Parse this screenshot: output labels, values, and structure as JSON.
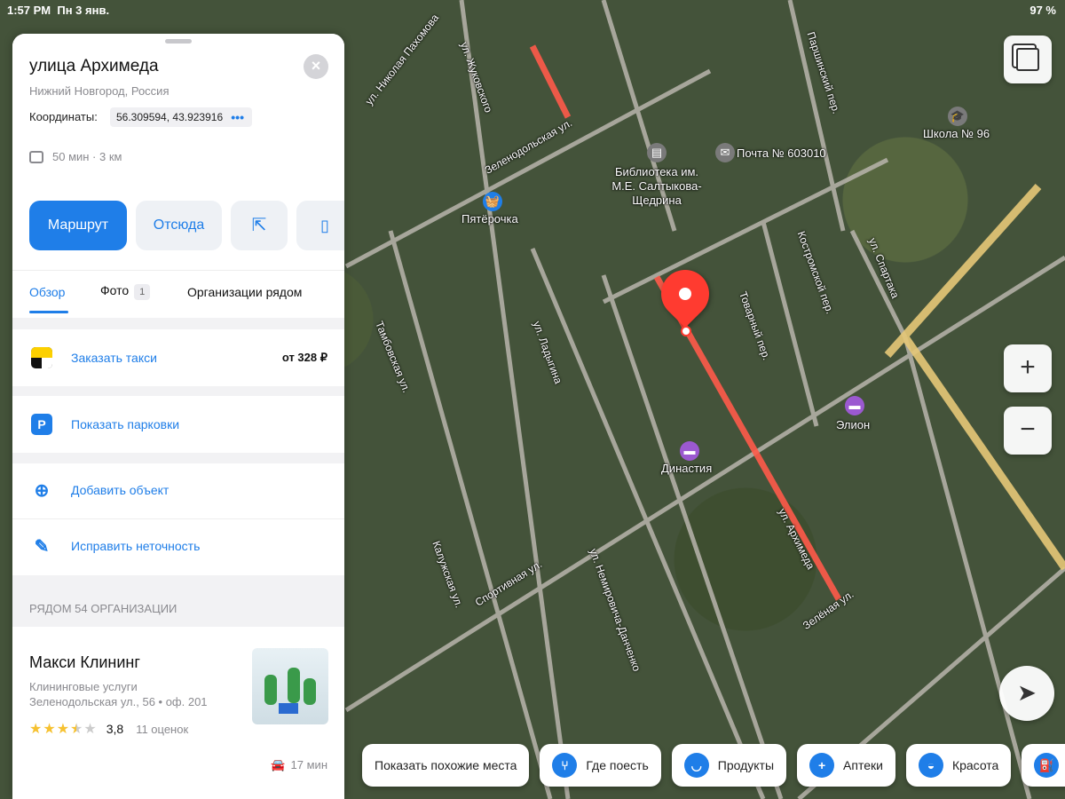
{
  "status_bar": {
    "time": "1:57 PM",
    "date": "Пн 3 янв.",
    "battery": "97 %"
  },
  "place": {
    "title": "улица Архимеда",
    "subtitle": "Нижний Новгород, Россия",
    "coords_label": "Координаты:",
    "coords_value": "56.309594, 43.923916",
    "transit": "50 мин · 3 км",
    "close_icon": "×"
  },
  "actions": {
    "route": "Маршрут",
    "from_here": "Отсюда"
  },
  "tabs": {
    "overview": "Обзор",
    "photos": "Фото",
    "photos_count": "1",
    "nearby": "Организации рядом"
  },
  "rows": {
    "taxi_label": "Заказать такси",
    "taxi_price": "от 328 ₽",
    "parking_label": "Показать парковки",
    "parking_icon": "P",
    "add_label": "Добавить объект",
    "fix_label": "Исправить неточность"
  },
  "nearby": {
    "header": "РЯДОМ 54 ОРГАНИЗАЦИИ",
    "org": {
      "name": "Макси Клининг",
      "category": "Клининговые услуги",
      "address": "Зеленодольская ул., 56 • оф. 201",
      "rating": "3,8",
      "reviews": "11 оценок",
      "stars": 3.5,
      "drive": "17 мин"
    }
  },
  "map": {
    "streets": [
      "Зеленодольская ул.",
      "ул. Жуковского",
      "ул. Архимеда",
      "ул. Ладыгина",
      "ул. Немировича-Данченко",
      "Спортивная ул.",
      "Товарный пер.",
      "Костромской пер.",
      "ул. Спартака",
      "Калужская ул.",
      "Зелёная ул.",
      "Паршинский пер.",
      "Тамбовская ул.",
      "ул. Николая Пахомова"
    ],
    "pois": {
      "library": "Библиотека им. М.Е. Салтыкова-Щедрина",
      "post": "Почта № 603010",
      "pyaterochka": "Пятёрочка",
      "dynasty": "Династия",
      "elion": "Элион",
      "school": "Школа № 96"
    }
  },
  "chips": {
    "similar": "Показать похожие места",
    "eat": "Где поесть",
    "food": "Продукты",
    "pharmacy": "Аптеки",
    "beauty": "Красота",
    "gas": "АЗ"
  },
  "map_controls": {
    "zoom_in": "+",
    "zoom_out": "−"
  },
  "colors": {
    "accent": "#1f7ee8",
    "highlight": "#ff3b30"
  }
}
